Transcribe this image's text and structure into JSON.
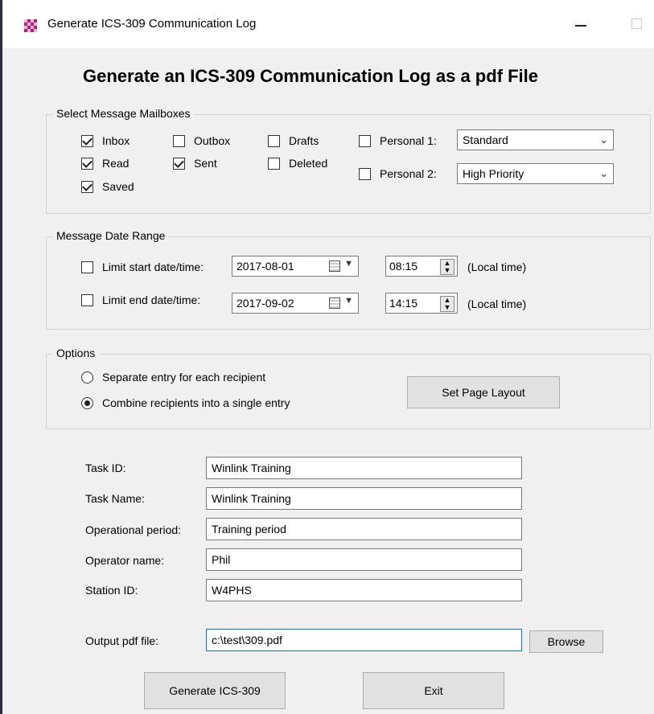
{
  "window": {
    "title": "Generate ICS-309 Communication Log"
  },
  "heading": "Generate an ICS-309 Communication Log as a pdf File",
  "mailboxes": {
    "group_label": "Select Message Mailboxes",
    "items": [
      {
        "label": "Inbox",
        "checked": true
      },
      {
        "label": "Read",
        "checked": true
      },
      {
        "label": "Saved",
        "checked": true
      },
      {
        "label": "Outbox",
        "checked": false
      },
      {
        "label": "Sent",
        "checked": true
      },
      {
        "label": "Drafts",
        "checked": false
      },
      {
        "label": "Deleted",
        "checked": false
      }
    ],
    "personal1": {
      "label": "Personal 1:",
      "checked": false,
      "value": "Standard"
    },
    "personal2": {
      "label": "Personal 2:",
      "checked": false,
      "value": "High Priority"
    }
  },
  "date_range": {
    "group_label": "Message Date Range",
    "start": {
      "label": "Limit start date/time:",
      "checked": false,
      "date": "2017-08-01",
      "time": "08:15",
      "note": "(Local time)"
    },
    "end": {
      "label": "Limit end date/time:",
      "checked": false,
      "date": "2017-09-02",
      "time": "14:15",
      "note": "(Local time)"
    }
  },
  "options": {
    "group_label": "Options",
    "radio1": "Separate entry for each recipient",
    "radio2": "Combine recipients into a single entry",
    "selected": 2,
    "page_layout_button": "Set Page Layout"
  },
  "fields": {
    "task_id": {
      "label": "Task ID:",
      "value": "Winlink Training"
    },
    "task_name": {
      "label": "Task Name:",
      "value": "Winlink Training"
    },
    "op_period": {
      "label": "Operational period:",
      "value": "Training period"
    },
    "operator": {
      "label": "Operator name:",
      "value": "Phil"
    },
    "station": {
      "label": "Station ID:",
      "value": "W4PHS"
    },
    "output": {
      "label": "Output pdf file:",
      "value": "c:\\test\\309.pdf"
    },
    "browse_button": "Browse"
  },
  "buttons": {
    "generate": "Generate ICS-309",
    "exit": "Exit"
  }
}
